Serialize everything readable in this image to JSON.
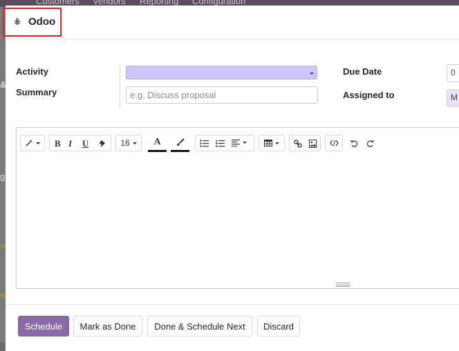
{
  "background": {
    "nav": [
      "Customers",
      "Vendors",
      "Reporting",
      "Configuration"
    ],
    "fragments": [
      "&",
      "g",
      "st",
      "st"
    ]
  },
  "dialog": {
    "title": "Odoo",
    "title_icon": "bug-icon"
  },
  "form": {
    "activity_label": "Activity",
    "activity_value": "",
    "summary_label": "Summary",
    "summary_placeholder": "e.g. Discuss proposal",
    "summary_value": "",
    "due_date_label": "Due Date",
    "due_date_value": "0",
    "assigned_label": "Assigned to",
    "assigned_value": "M"
  },
  "toolbar": {
    "style_icon": "magic-wand-icon",
    "bold": "B",
    "italic": "I",
    "underline": "U",
    "eraser_icon": "eraser-icon",
    "font_size": "16",
    "font_color": "A",
    "background_color_icon": "paintbrush-icon",
    "unordered_list_icon": "unordered-list-icon",
    "ordered_list_icon": "ordered-list-icon",
    "align_icon": "align-left-icon",
    "table_icon": "table-icon",
    "link_icon": "link-icon",
    "image_icon": "image-icon",
    "codeview_icon": "code-view-icon",
    "undo_icon": "undo-icon",
    "redo_icon": "redo-icon"
  },
  "footer": {
    "schedule": "Schedule",
    "mark_done": "Mark as Done",
    "done_schedule_next": "Done & Schedule Next",
    "discard": "Discard"
  },
  "colors": {
    "primary": "#8a6aa6",
    "activity_field": "#cfc4f5",
    "highlight_border": "#e02424",
    "topbar": "#5a4c5c"
  }
}
